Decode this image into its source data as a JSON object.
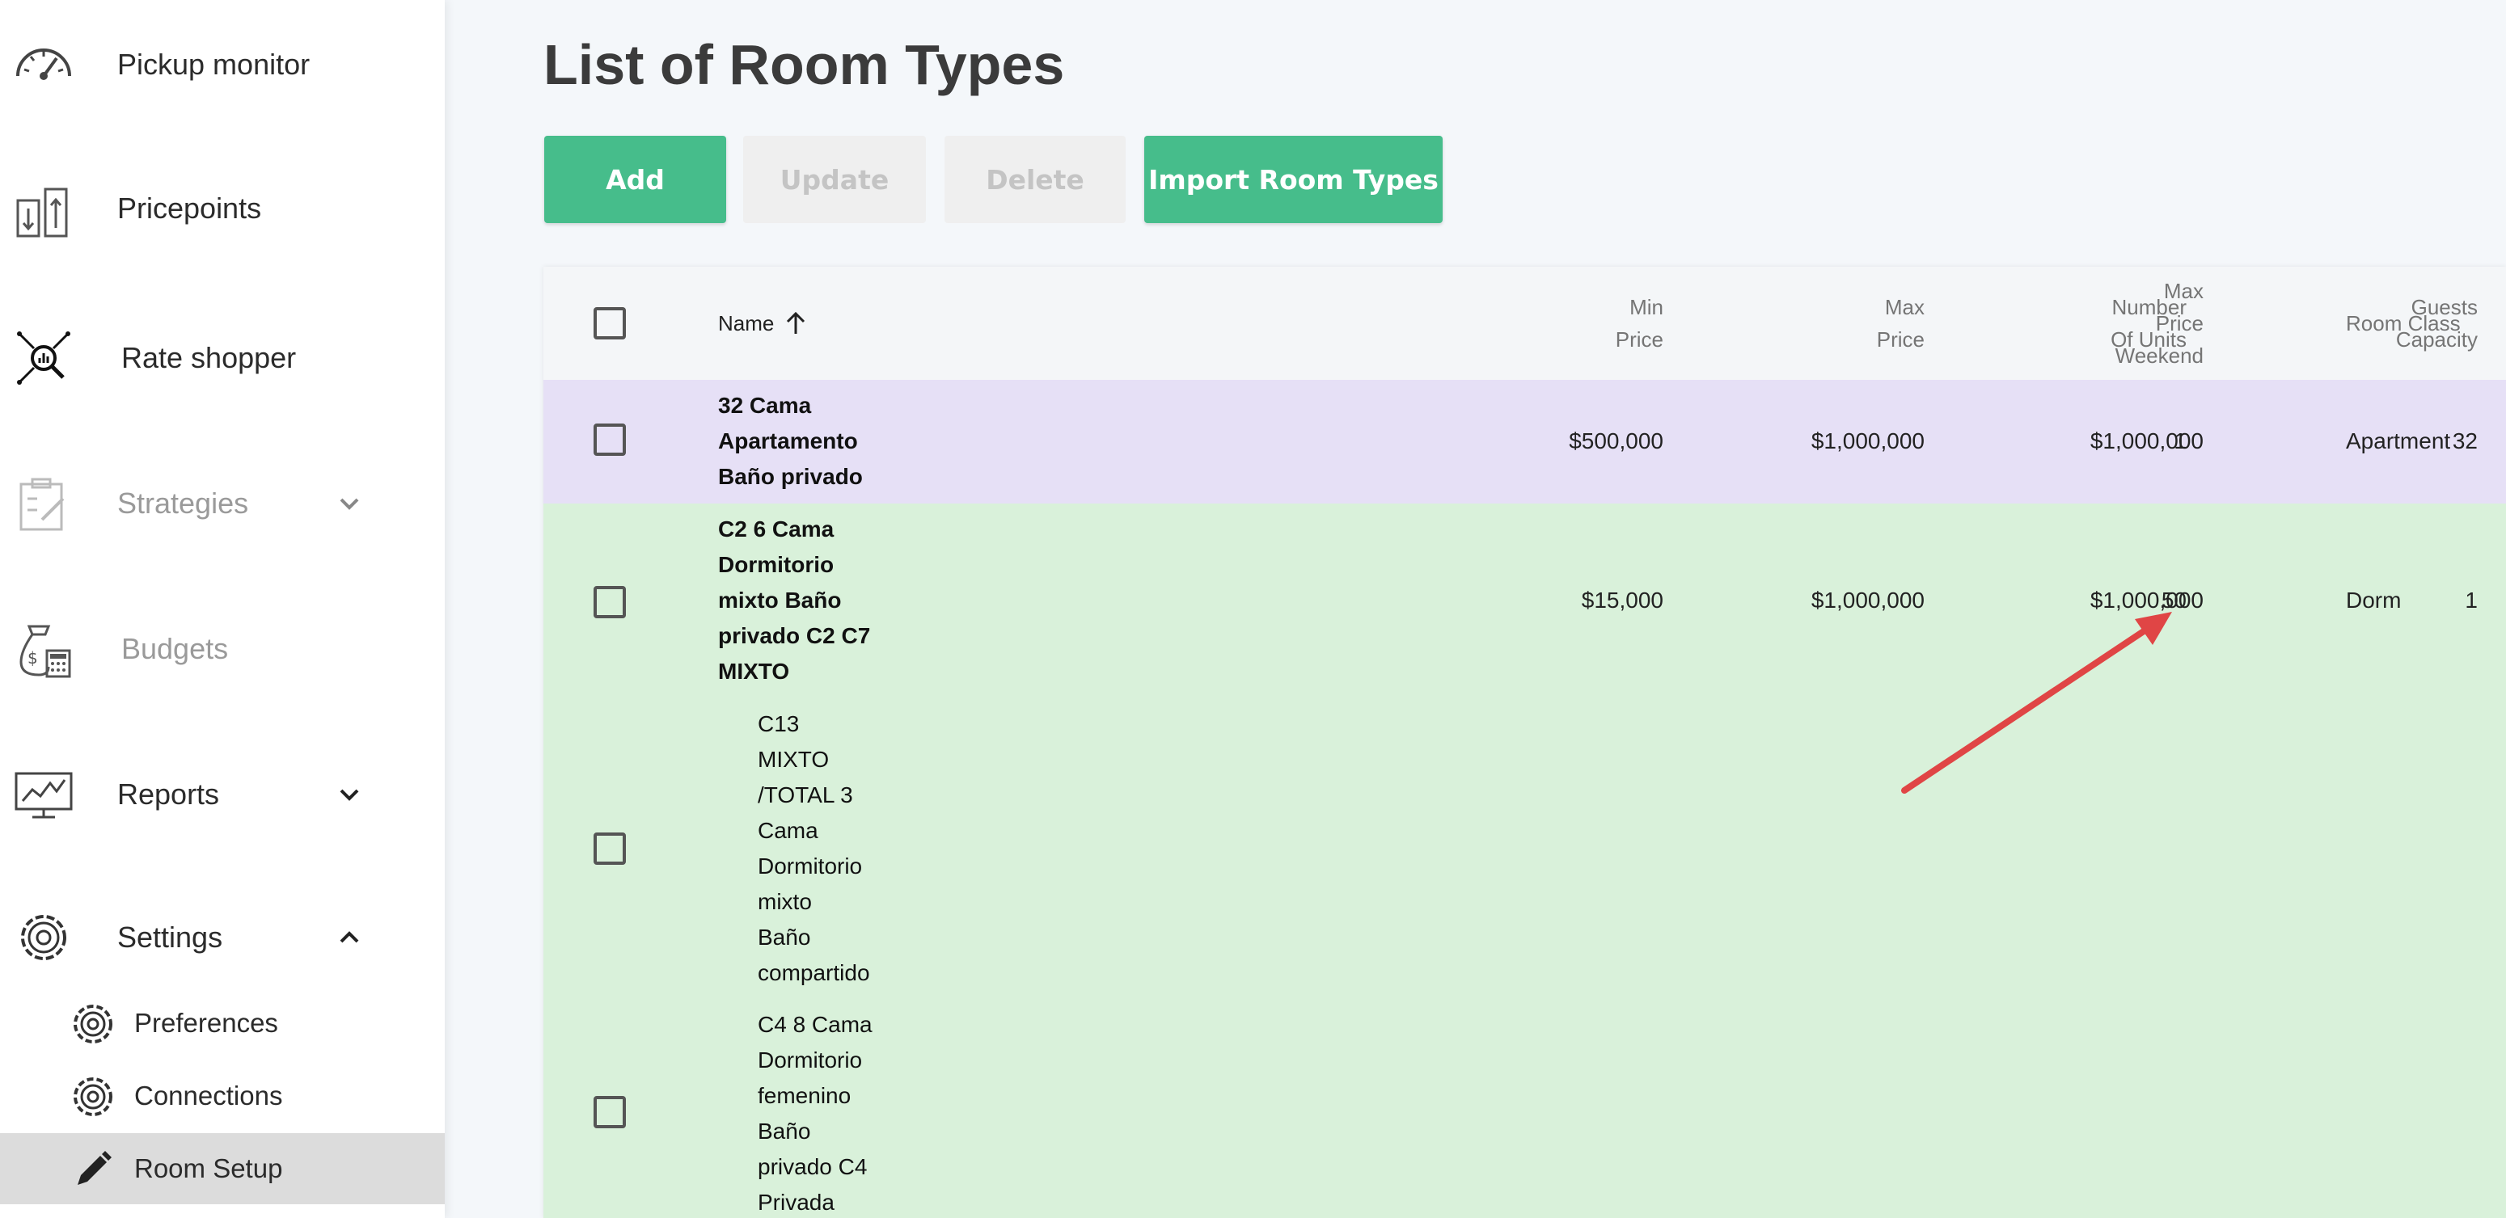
{
  "sidebar": {
    "items": [
      {
        "label": "Pickup monitor",
        "icon": "speedometer-icon"
      },
      {
        "label": "Pricepoints",
        "icon": "pricepoints-icon"
      },
      {
        "label": "Rate shopper",
        "icon": "rate-shopper-icon"
      },
      {
        "label": "Strategies",
        "icon": "strategies-icon",
        "disabled": true
      },
      {
        "label": "Budgets",
        "icon": "budget-bag-icon",
        "disabled": true
      },
      {
        "label": "Reports",
        "icon": "reports-monitor-icon"
      },
      {
        "label": "Settings",
        "icon": "gear-icon"
      }
    ],
    "settings_sub": [
      {
        "label": "Preferences",
        "icon": "gear-icon"
      },
      {
        "label": "Connections",
        "icon": "gear-icon"
      },
      {
        "label": "Room Setup",
        "icon": "pencil-icon",
        "active": true
      }
    ]
  },
  "main": {
    "title": "List of Room Types",
    "buttons": {
      "add": "Add",
      "update": "Update",
      "delete": "Delete",
      "import": "Import Room Types"
    },
    "columns": {
      "name": "Name",
      "min_price": "Min\nPrice",
      "max_price": "Max\nPrice",
      "max_price_weekend": "Max\nPrice\nWeekend",
      "guests_capacity": "Guests\nCapacity",
      "number_of_units": "Number\nOf Units",
      "room_class": "Room Class"
    },
    "rows": [
      {
        "name": "32 Cama\nApartamento\nBaño privado",
        "min_price": "$500,000",
        "max_price": "$1,000,000",
        "max_price_weekend": "$1,000,000",
        "guests_capacity": "32",
        "number_of_units": "1",
        "room_class": "Apartment"
      },
      {
        "name": "C2 6 Cama\nDormitorio\nmixto Baño\nprivado C2 C7\nMIXTO",
        "min_price": "$15,000",
        "max_price": "$1,000,000",
        "max_price_weekend": "$1,000,000",
        "guests_capacity": "1",
        "number_of_units": "50",
        "room_class": "Dorm"
      },
      {
        "name": "C13\nMIXTO\n/TOTAL 3\nCama\nDormitorio\nmixto\nBaño\ncompartido"
      },
      {
        "name": "C4 8 Cama\nDormitorio\nfemenino\nBaño\nprivado C4\nPrivada"
      }
    ]
  },
  "colors": {
    "accent": "#46bd8b",
    "row_purple": "#e6e0f6",
    "row_green": "#d9f1da",
    "annotation_arrow": "#e04545"
  }
}
